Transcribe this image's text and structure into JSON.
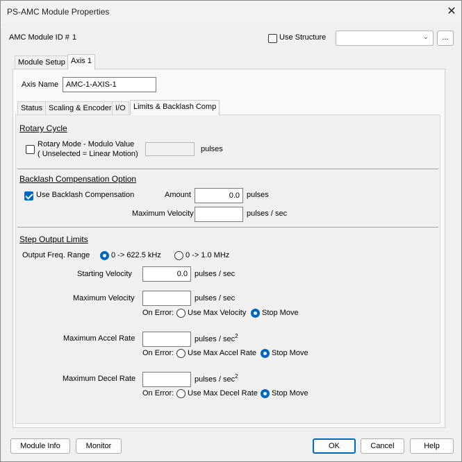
{
  "window": {
    "title": "PS-AMC Module Properties",
    "close_glyph": "✕"
  },
  "header": {
    "module_id_label": "AMC Module ID #",
    "module_id_value": "1",
    "use_structure_label": "Use Structure",
    "use_structure_checked": false,
    "structure_combo_value": "",
    "browse_label": "..."
  },
  "outer_tabs": [
    {
      "label": "Module Setup"
    },
    {
      "label": "Axis 1"
    }
  ],
  "axis": {
    "name_label": "Axis Name",
    "name_value": "AMC-1-AXIS-1"
  },
  "inner_tabs": [
    {
      "label": "Status"
    },
    {
      "label": "Scaling & Encoder"
    },
    {
      "label": "I/O"
    },
    {
      "label": "Limits & Backlash Comp"
    }
  ],
  "rotary": {
    "title": "Rotary Cycle",
    "checkbox_label_1": "Rotary Mode - Modulo Value",
    "checkbox_label_2": "( Unselected = Linear Motion)",
    "checked": false,
    "value": "",
    "unit": "pulses"
  },
  "backlash": {
    "title": "Backlash Compensation Option",
    "checkbox_label": "Use Backlash Compensation",
    "checked": true,
    "amount_label": "Amount",
    "amount_value": "0.0",
    "amount_unit": "pulses",
    "max_vel_label": "Maximum Velocity",
    "max_vel_value": "",
    "max_vel_unit": "pulses / sec"
  },
  "step": {
    "title": "Step Output Limits",
    "freq_label": "Output Freq. Range",
    "freq_opt1": "0 -> 622.5 kHz",
    "freq_opt2": "0 -> 1.0 MHz",
    "freq_selected": 1,
    "start_vel_label": "Starting Velocity",
    "start_vel_value": "0.0",
    "start_vel_unit": "pulses / sec",
    "max_vel_label": "Maximum Velocity",
    "max_vel_value": "",
    "max_vel_unit": "pulses / sec",
    "on_error_label": "On Error:",
    "vel_err_opt1": "Use Max Velocity",
    "vel_err_opt2": "Stop Move",
    "accel_label": "Maximum Accel Rate",
    "accel_value": "",
    "accel_unit": "pulses / sec",
    "accel_err_opt1": "Use Max Accel Rate",
    "accel_err_opt2": "Stop Move",
    "decel_label": "Maximum Decel Rate",
    "decel_value": "",
    "decel_unit": "pulses / sec",
    "decel_err_opt1": "Use Max Decel Rate",
    "decel_err_opt2": "Stop Move",
    "sup": "2"
  },
  "footer": {
    "module_info": "Module Info",
    "monitor": "Monitor",
    "ok": "OK",
    "cancel": "Cancel",
    "help": "Help"
  }
}
